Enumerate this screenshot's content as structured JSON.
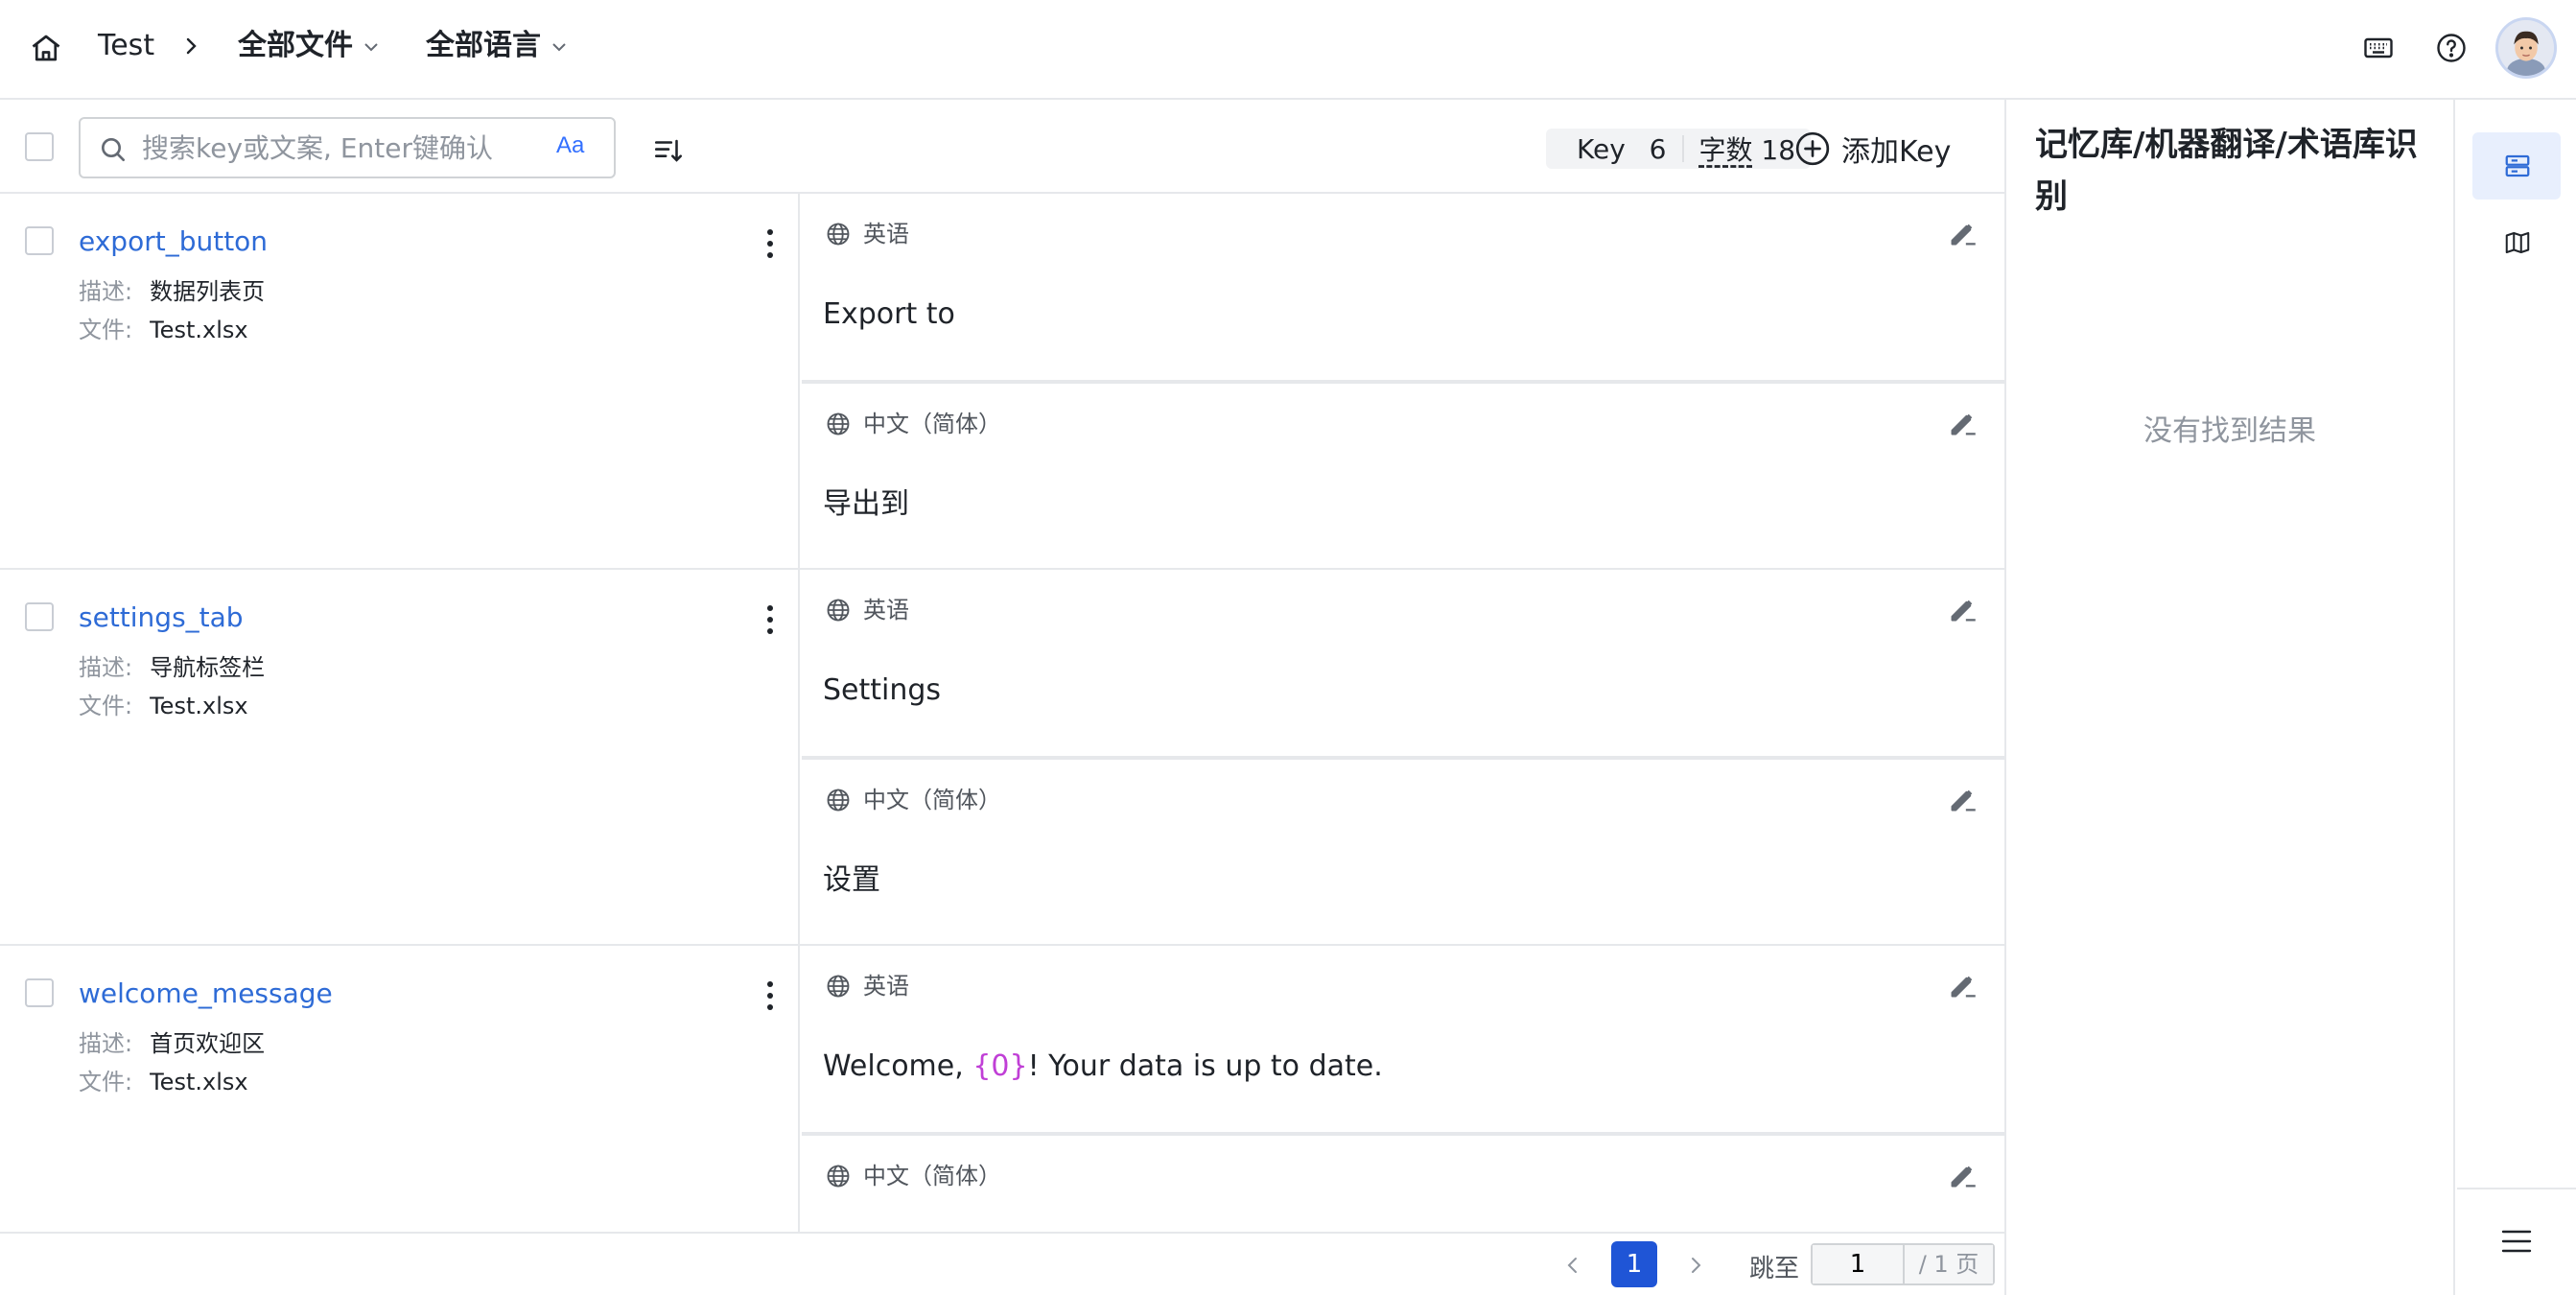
{
  "breadcrumb": {
    "project": "Test",
    "files_dropdown": "全部文件",
    "languages_dropdown": "全部语言"
  },
  "search": {
    "placeholder": "搜索key或文案, Enter键确认",
    "case_toggle": "Aa"
  },
  "stats": {
    "key_label": "Key",
    "key_count": "6",
    "words_label": "字数",
    "words_count": "18"
  },
  "add_key_label": "添加Key",
  "meta_labels": {
    "description": "描述:",
    "file": "文件:"
  },
  "keys": [
    {
      "name": "export_button",
      "description": "数据列表页",
      "file": "Test.xlsx",
      "translations": [
        {
          "language": "英语",
          "text": "Export to"
        },
        {
          "language": "中文（简体）",
          "text": "导出到"
        }
      ]
    },
    {
      "name": "settings_tab",
      "description": "导航标签栏",
      "file": "Test.xlsx",
      "translations": [
        {
          "language": "英语",
          "text": "Settings"
        },
        {
          "language": "中文（简体）",
          "text": "设置"
        }
      ]
    },
    {
      "name": "welcome_message",
      "description": "首页欢迎区",
      "file": "Test.xlsx",
      "translations": [
        {
          "language": "英语",
          "text_before": "Welcome, ",
          "placeholder": "{0}",
          "text_after": "! Your data is up to date."
        },
        {
          "language": "中文（简体）",
          "text": ""
        }
      ]
    }
  ],
  "pagination": {
    "current_page": "1",
    "jump_label": "跳至",
    "jump_value": "1",
    "total": "/ 1 页"
  },
  "right_panel": {
    "title": "记忆库/机器翻译/术语库识别",
    "empty_text": "没有找到结果"
  },
  "icons": {
    "home": "home-icon",
    "breadcrumb_separator": "chevron-right-icon",
    "keyboard": "keyboard-icon",
    "help": "help-circle-icon",
    "search": "search-icon",
    "sort": "sort-icon",
    "add": "plus-circle-icon",
    "globe": "globe-icon",
    "edit": "edit-icon",
    "more": "more-vertical-icon",
    "panel": "panel-list-icon",
    "map": "map-icon",
    "menu": "menu-icon"
  },
  "colors": {
    "link": "#2e6bd6",
    "primary": "#1f55d6",
    "placeholder_token": "#c03fd6",
    "active_tab_bg": "#e8effd"
  }
}
